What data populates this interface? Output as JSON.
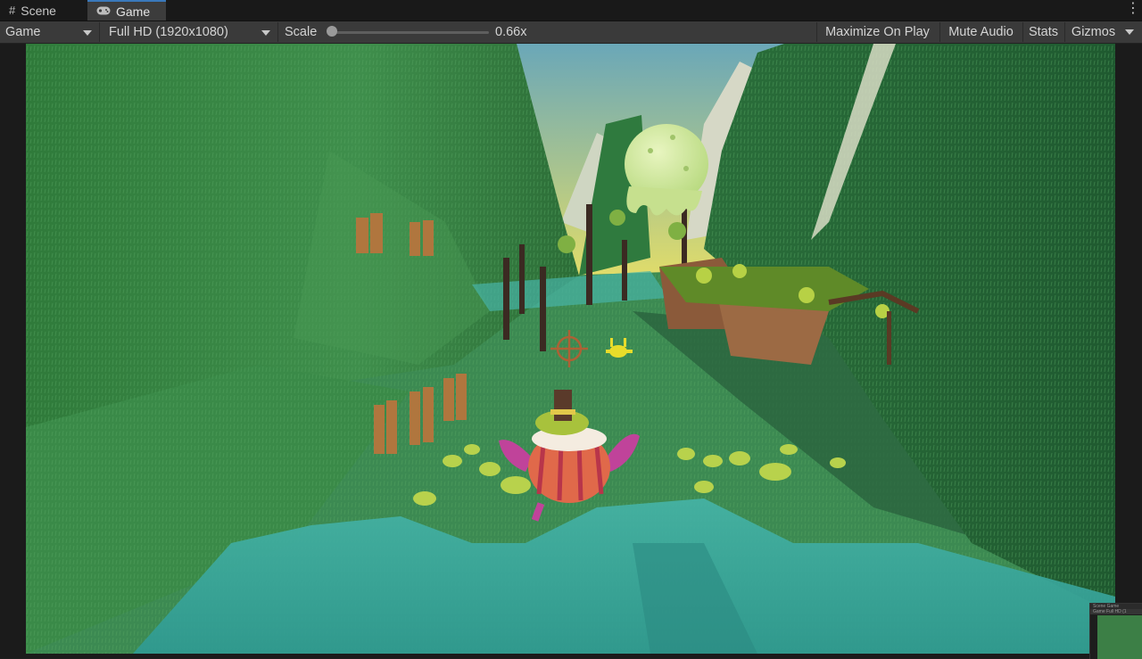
{
  "tabs": [
    {
      "label": "Scene",
      "icon": "grid-icon"
    },
    {
      "label": "Game",
      "icon": "gamepad-icon",
      "active": true
    }
  ],
  "toolbar": {
    "display_select": "Game",
    "resolution_select": "Full HD (1920x1080)",
    "scale_label": "Scale",
    "scale_value": "0.66x",
    "maximize_on_play": "Maximize On Play",
    "mute_audio": "Mute Audio",
    "stats": "Stats",
    "gizmos": "Gizmos"
  },
  "thumbnail": {
    "tabs": [
      "Scene",
      "Game"
    ],
    "select": "Game",
    "resolution": "Full HD (1"
  },
  "colors": {
    "panel_bg": "#1e1e1e",
    "toolbar_bg": "#3a3a3a",
    "active_tab_accent": "#3a79bb",
    "grass": "#3f8a4a",
    "water": "#3fb3a8",
    "sky_top": "#6aa7b8",
    "sky_bottom": "#e0dc6a"
  }
}
